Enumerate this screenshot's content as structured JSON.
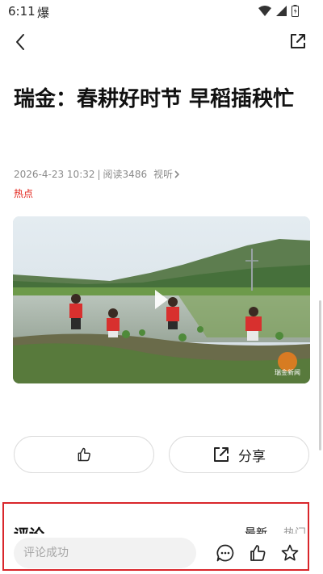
{
  "status_bar": {
    "time": "6:11",
    "flag": "爆"
  },
  "article": {
    "title": "瑞金：春耕好时节 早稻插秧忙",
    "date": "2026-4-23 10:32",
    "divider": "|",
    "reads": "阅读3486",
    "listen": "视听",
    "tag": "热点"
  },
  "video": {
    "watermark": "瑞金新闻"
  },
  "actions": {
    "share_label": "分享"
  },
  "comments": {
    "title": "评论",
    "sort_new": "最新",
    "sort_hot": "热门"
  },
  "bottom_bar": {
    "input_placeholder": "评论成功"
  },
  "icons": {
    "back": "chevron-left-icon",
    "share_top": "share-icon",
    "like": "thumbs-up-icon",
    "comment": "comment-icon",
    "favorite": "star-icon"
  },
  "colors": {
    "hot_tag": "#e2231a",
    "highlight": "#d9262b",
    "accent_text": "#111111"
  }
}
